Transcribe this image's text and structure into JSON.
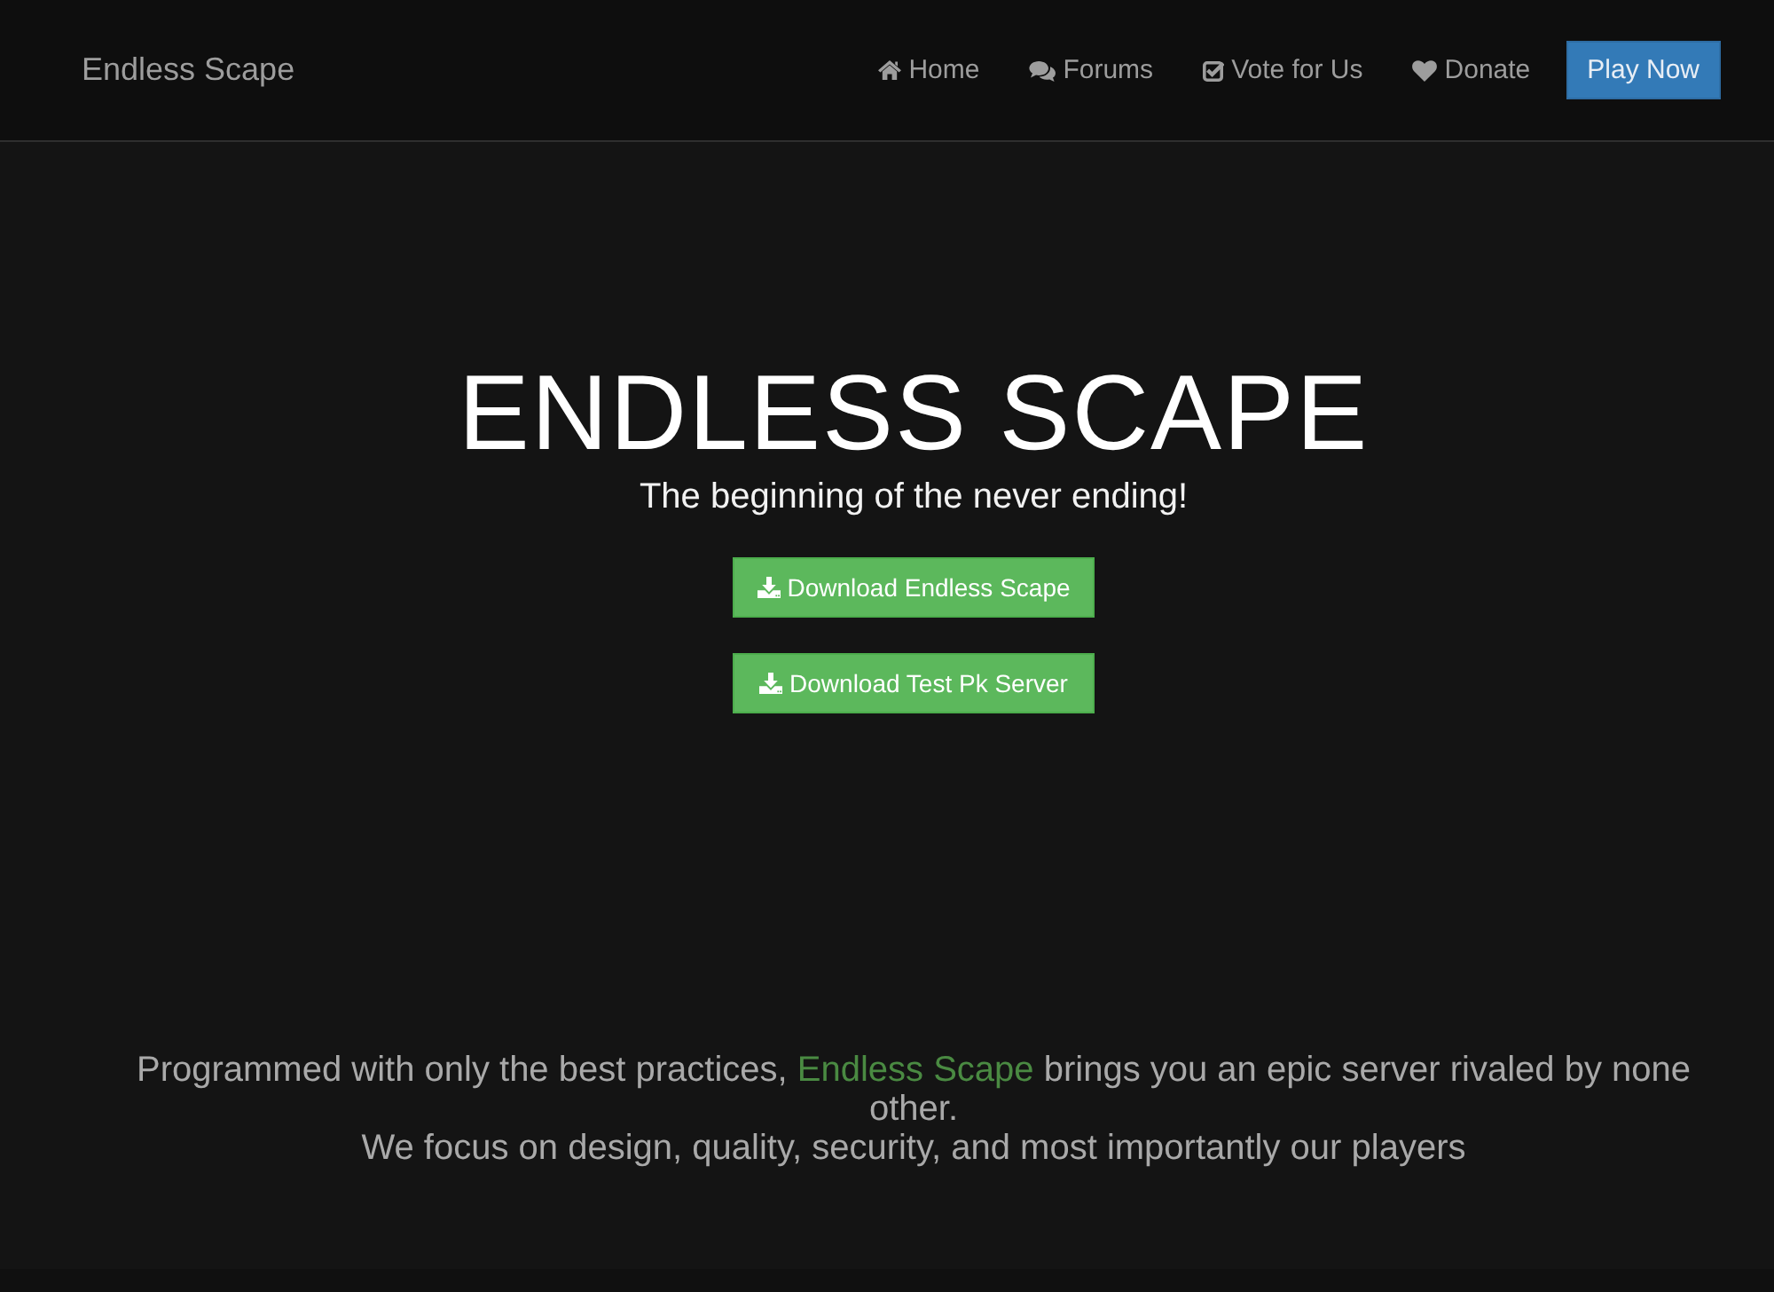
{
  "navbar": {
    "brand": "Endless Scape",
    "links": [
      {
        "label": "Home"
      },
      {
        "label": "Forums"
      },
      {
        "label": "Vote for Us"
      },
      {
        "label": "Donate"
      }
    ],
    "play_button": "Play Now"
  },
  "hero": {
    "title": "ENDLESS SCAPE",
    "subtitle": "The beginning of the never ending!",
    "buttons": [
      {
        "label": "Download Endless Scape"
      },
      {
        "label": "Download Test Pk Server"
      }
    ]
  },
  "about": {
    "intro": {
      "before": "Programmed with only the best practices,",
      "highlight": "Endless Scape",
      "after": "brings you an epic server rivaled by none other."
    },
    "focus": "We focus on design, quality, security, and most importantly our players"
  }
}
